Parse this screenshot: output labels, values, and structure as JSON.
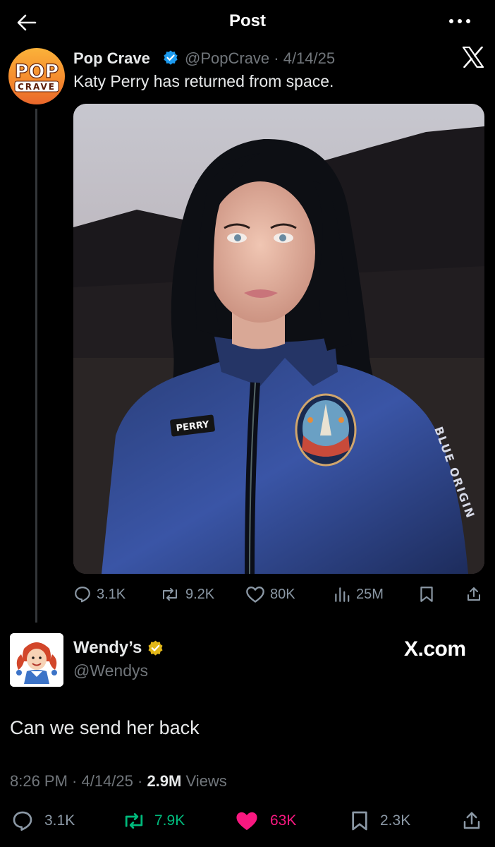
{
  "header": {
    "title": "Post",
    "back_icon": "arrow-left-icon",
    "more_icon": "more-horizontal-icon"
  },
  "quoted_post": {
    "author_name": "Pop Crave",
    "handle_date": "@PopCrave · 4/14/25",
    "avatar_text_top": "POP",
    "avatar_text_bottom": "CRAVE",
    "text": "Katy Perry has returned from space.",
    "photo_patch_text": "PERRY",
    "photo_sleeve_text": "BLUE ORIGIN",
    "stats": {
      "replies": "3.1K",
      "reposts": "9.2K",
      "likes": "80K",
      "views": "25M"
    }
  },
  "main_post": {
    "author_name": "Wendy’s",
    "handle": "@Wendys",
    "watermark": "X.com",
    "text": "Can we send her back",
    "time_date": "8:26 PM · 4/14/25 · ",
    "views_count": "2.9M",
    "views_label": " Views",
    "stats": {
      "replies": "3.1K",
      "reposts": "7.9K",
      "likes": "63K",
      "bookmarks": "2.3K"
    }
  },
  "colors": {
    "background": "#000000",
    "repost_active": "#00ba7c",
    "like_active": "#f91880",
    "verified_blue": "#1d9bf0",
    "verified_gold": "#e2b719"
  }
}
